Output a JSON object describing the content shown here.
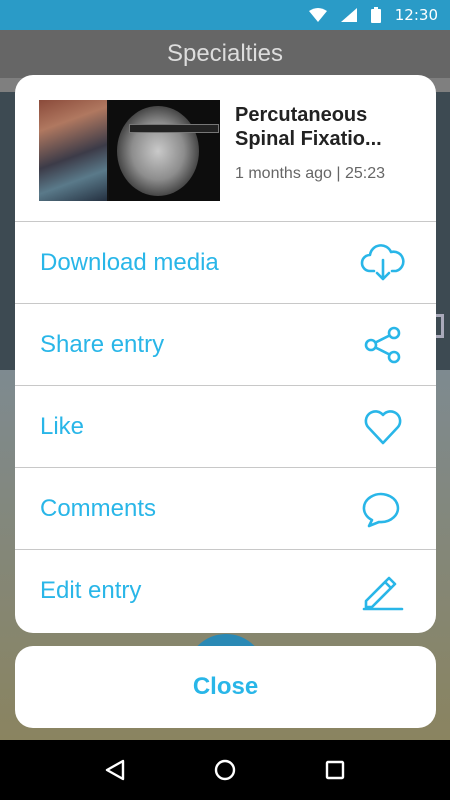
{
  "status_bar": {
    "time": "12:30",
    "icons": [
      "wifi-icon",
      "signal-icon",
      "battery-icon"
    ]
  },
  "background": {
    "title": "Specialties"
  },
  "entry": {
    "title_line1": "Percutaneous",
    "title_line2": "Spinal Fixatio...",
    "meta": "1 months ago | 25:23"
  },
  "menu": {
    "items": [
      {
        "label": "Download media",
        "icon": "cloud-download-icon"
      },
      {
        "label": "Share entry",
        "icon": "share-icon"
      },
      {
        "label": "Like",
        "icon": "heart-icon"
      },
      {
        "label": "Comments",
        "icon": "speech-bubble-icon"
      },
      {
        "label": "Edit entry",
        "icon": "pencil-icon"
      }
    ]
  },
  "close_label": "Close",
  "nav": [
    "back-icon",
    "home-icon",
    "recents-icon"
  ],
  "colors": {
    "accent": "#29b6e8",
    "status_bar": "#2a9bc7"
  }
}
